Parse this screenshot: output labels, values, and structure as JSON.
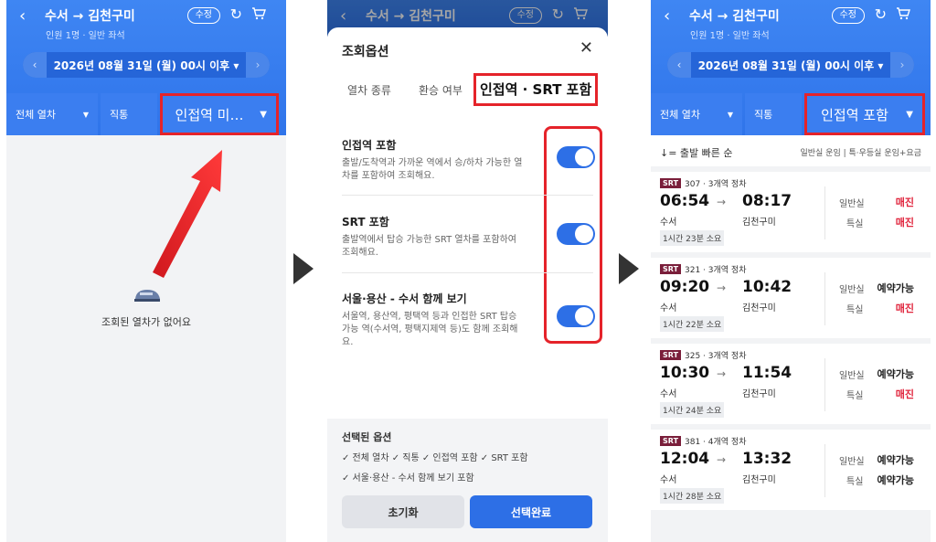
{
  "header": {
    "route": "수서 → 김천구미",
    "subtitle": "인원 1명 · 일반 좌석",
    "edit_label": "수정",
    "date_label": "2026년 08월 31일 (월) 00시 이후 ▾"
  },
  "filters": {
    "all_trains": "전체 열차",
    "direct": "직통",
    "nearby_off": "인접역 미…",
    "nearby_on": "인접역 포함"
  },
  "empty_state": {
    "message": "조회된 열차가 없어요"
  },
  "modal": {
    "title": "조회옵션",
    "tabs": [
      "열차 종류",
      "환승 여부",
      "인접역 · SRT 포함"
    ],
    "options": [
      {
        "title": "인접역 포함",
        "desc": "출발/도착역과 가까운 역에서 승/하차 가능한 열차를 포함하여 조회해요.",
        "on": true
      },
      {
        "title": "SRT 포함",
        "desc": "출발역에서 탑승 가능한 SRT 열차를 포함하여 조회해요.",
        "on": true
      },
      {
        "title": "서울·용산 - 수서 함께 보기",
        "desc": "서울역, 용산역, 평택역 등과 인접한 SRT 탑승 가능 역(수서역, 평택지제역 등)도 함께 조회해요.",
        "on": true
      }
    ],
    "selected_title": "선택된 옵션",
    "selected_line1": "✓ 전체 열차  ✓ 직통  ✓ 인접역 포함  ✓ SRT 포함",
    "selected_line2": "✓ 서울·용산 - 수서 함께 보기 포함",
    "reset_label": "초기화",
    "done_label": "선택완료"
  },
  "results": {
    "sort_label": "↓= 출발 빠른 순",
    "legend": "일반실 운임 | 특·우등실 운임+요금",
    "class_general": "일반실",
    "class_special": "특실",
    "trains": [
      {
        "badge": "SRT",
        "no": "307 · 3개역 정차",
        "dep": "06:54",
        "arr": "08:17",
        "dep_st": "수서",
        "arr_st": "김천구미",
        "dur": "1시간 23분 소요",
        "general": "매진",
        "special": "매진",
        "general_sold": true,
        "special_sold": true
      },
      {
        "badge": "SRT",
        "no": "321 · 3개역 정차",
        "dep": "09:20",
        "arr": "10:42",
        "dep_st": "수서",
        "arr_st": "김천구미",
        "dur": "1시간 22분 소요",
        "general": "예약가능",
        "special": "매진",
        "general_sold": false,
        "special_sold": true
      },
      {
        "badge": "SRT",
        "no": "325 · 3개역 정차",
        "dep": "10:30",
        "arr": "11:54",
        "dep_st": "수서",
        "arr_st": "김천구미",
        "dur": "1시간 24분 소요",
        "general": "예약가능",
        "special": "매진",
        "general_sold": false,
        "special_sold": true
      },
      {
        "badge": "SRT",
        "no": "381 · 4개역 정차",
        "dep": "12:04",
        "arr": "13:32",
        "dep_st": "수서",
        "arr_st": "김천구미",
        "dur": "1시간 28분 소요",
        "general": "예약가능",
        "special": "예약가능",
        "general_sold": false,
        "special_sold": false
      }
    ]
  },
  "colors": {
    "brand_blue": "#2f74ea",
    "highlight_red": "#e5232a",
    "sold_out_red": "#e0243c",
    "srt_badge": "#7a1e3a"
  }
}
